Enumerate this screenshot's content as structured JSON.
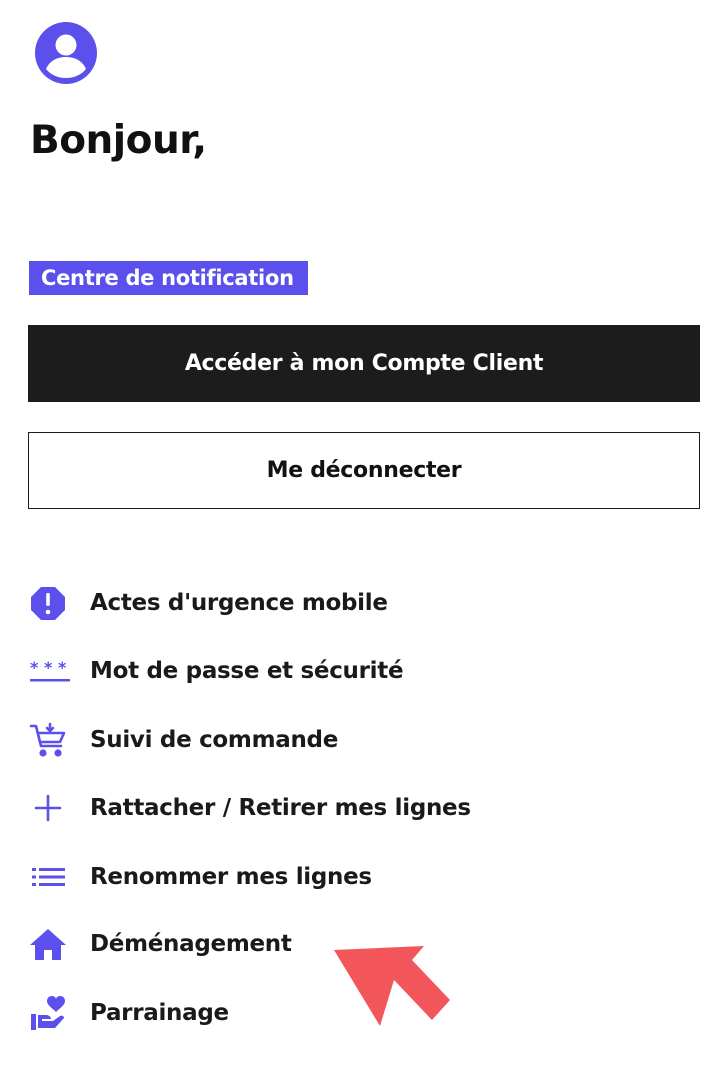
{
  "header": {
    "avatar_icon": "user-circle-icon",
    "greeting": "Bonjour,"
  },
  "notification_link": {
    "label": "Centre de notification"
  },
  "buttons": {
    "account": "Accéder à mon Compte Client",
    "logout": "Me déconnecter"
  },
  "menu": {
    "items": [
      {
        "label": "Actes d'urgence mobile",
        "icon": "alert-octagon-icon"
      },
      {
        "label": "Mot de passe et sécurité",
        "icon": "password-dots-icon"
      },
      {
        "label": "Suivi de commande",
        "icon": "cart-arrow-icon"
      },
      {
        "label": "Rattacher / Retirer mes lignes",
        "icon": "plus-icon"
      },
      {
        "label": "Renommer mes lignes",
        "icon": "list-icon"
      },
      {
        "label": "Déménagement",
        "icon": "home-icon"
      },
      {
        "label": "Parrainage",
        "icon": "hand-heart-icon"
      }
    ]
  },
  "colors": {
    "accent": "#5b50eb",
    "primary_button": "#1c1c1c",
    "annotation_arrow": "#f2555a"
  }
}
